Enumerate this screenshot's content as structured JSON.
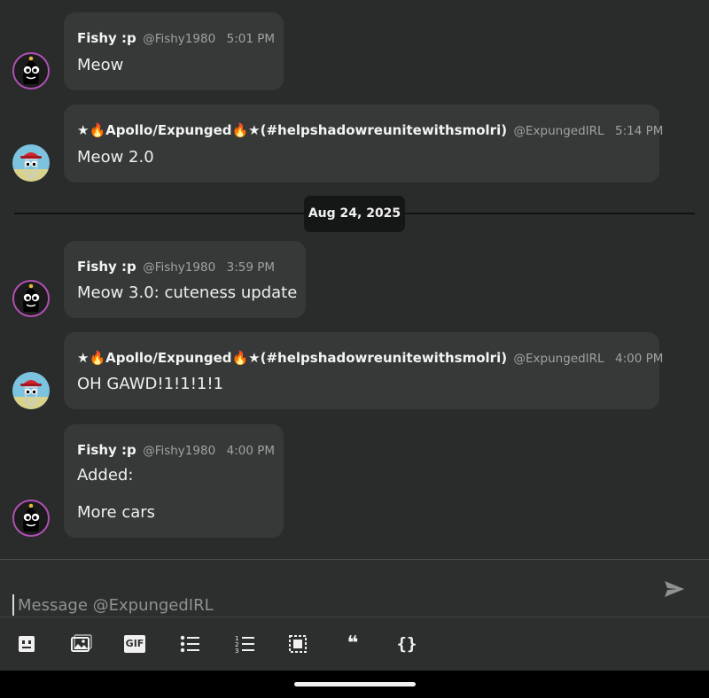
{
  "chat": {
    "date_separator": "Aug 24, 2025",
    "messages": [
      {
        "author": "Fishy :p",
        "handle": "@Fishy1980",
        "time": "5:01 PM",
        "lines": [
          "Meow"
        ]
      },
      {
        "author": "★🔥Apollo/Expunged🔥★(#helpshadowreunitewithsmolri)",
        "handle": "@ExpungedIRL",
        "time": "5:14 PM",
        "lines": [
          "Meow 2.0"
        ]
      },
      {
        "author": "Fishy :p",
        "handle": "@Fishy1980",
        "time": "3:59 PM",
        "lines": [
          "Meow 3.0: cuteness update"
        ]
      },
      {
        "author": "★🔥Apollo/Expunged🔥★(#helpshadowreunitewithsmolri)",
        "handle": "@ExpungedIRL",
        "time": "4:00 PM",
        "lines": [
          "OH GAWD!1!1!1!1"
        ]
      },
      {
        "author": "Fishy :p",
        "handle": "@Fishy1980",
        "time": "4:00 PM",
        "lines": [
          "Added:",
          "More cars"
        ]
      }
    ]
  },
  "composer": {
    "placeholder": "Message @ExpungedIRL",
    "value": ""
  },
  "toolbar": {
    "icons": [
      "emoji-icon",
      "image-icon",
      "gif-icon",
      "bullet-list-icon",
      "numbered-list-icon",
      "select-icon",
      "quote-icon",
      "code-block-icon"
    ],
    "gif_label": "GIF",
    "quote_glyph": "❝",
    "code_glyph": "{}"
  }
}
